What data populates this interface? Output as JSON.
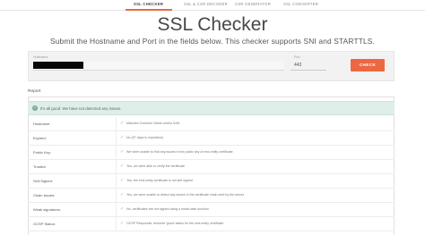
{
  "nav": {
    "tabs": [
      {
        "label": "SSL CHECKER"
      },
      {
        "label": "SSL & CSR DECODER"
      },
      {
        "label": "CSR GENERATOR"
      },
      {
        "label": "SSL CONVERTER"
      }
    ]
  },
  "page": {
    "title": "SSL Checker",
    "subtitle": "Submit the Hostname and Port in the fields below. This checker supports SNI and STARTTLS."
  },
  "form": {
    "hostname_label": "Hostname",
    "port_label": "Port",
    "port_value": "443",
    "check_button": "CHECK"
  },
  "report": {
    "heading": "Report",
    "banner": "It's all good. We have not detected any issues.",
    "rows": [
      {
        "label": "Hostname:",
        "value": "Matches Common Name and/or SAN"
      },
      {
        "label": "Expired:",
        "value": "No (97 days to expiration)"
      },
      {
        "label": "Public Key:",
        "value": "We were unable to find any issues in the public key of end-entity certificate"
      },
      {
        "label": "Trusted:",
        "value": "Yes, we were able to verify the certificate"
      },
      {
        "label": "Self-Signed:",
        "value": "Yes, the end-entity certificate is not self signed"
      },
      {
        "label": "Chain Issues:",
        "value": "Yes, we were unable to detect any issues in the certificate chain sent by the server"
      },
      {
        "label": "Weak signatures:",
        "value": "No, certificates are not signed using a weak hash function"
      },
      {
        "label": "OCSP Status:",
        "value": "OCSP Responder returned 'good' status for the end-entity certificate"
      }
    ]
  },
  "colors": {
    "accent": "#ec6841",
    "banner_bg": "#dfeee8",
    "check_mark": "#8bb7a2"
  }
}
